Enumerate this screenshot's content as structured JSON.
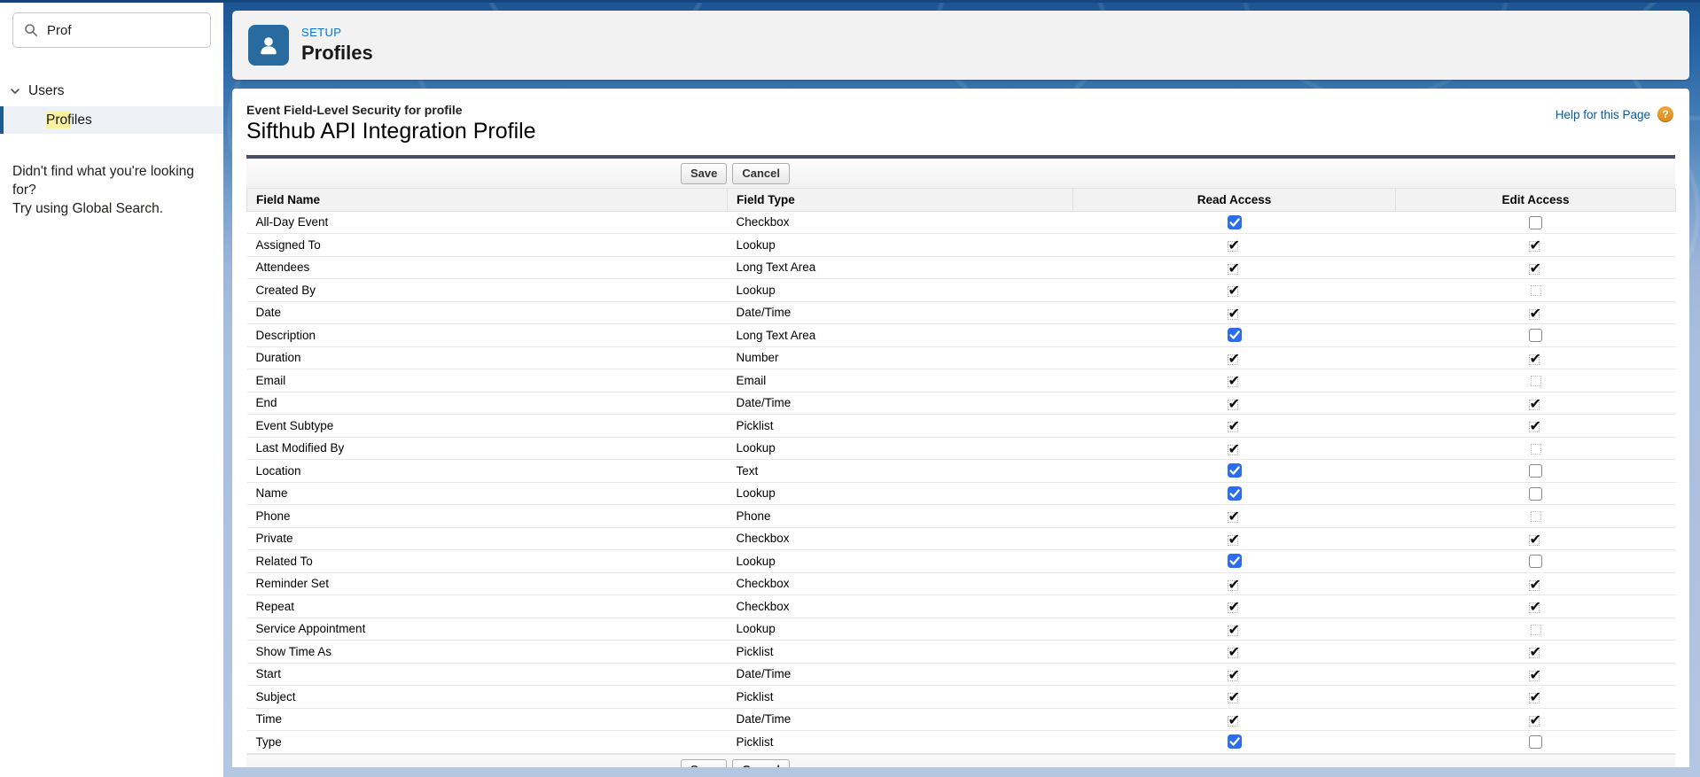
{
  "sidebar": {
    "search": {
      "value": "Prof"
    },
    "section_label": "Users",
    "item": {
      "highlight": "Prof",
      "rest": "iles"
    },
    "notfound_line1": "Didn't find what you're looking for?",
    "notfound_line2": "Try using Global Search."
  },
  "header": {
    "eyebrow": "SETUP",
    "title": "Profiles"
  },
  "page": {
    "subtitle": "Event Field-Level Security for profile",
    "title": "Sifthub API Integration Profile",
    "help_link": "Help for this Page",
    "help_icon_glyph": "?"
  },
  "toolbar": {
    "save_label": "Save",
    "cancel_label": "Cancel"
  },
  "table": {
    "columns": [
      "Field Name",
      "Field Type",
      "Read Access",
      "Edit Access"
    ],
    "rows": [
      {
        "name": "All-Day Event",
        "type": "Checkbox",
        "read": "checked",
        "edit": "unchecked"
      },
      {
        "name": "Assigned To",
        "type": "Lookup",
        "read": "check",
        "edit": "check"
      },
      {
        "name": "Attendees",
        "type": "Long Text Area",
        "read": "check",
        "edit": "check"
      },
      {
        "name": "Created By",
        "type": "Lookup",
        "read": "check",
        "edit": "none"
      },
      {
        "name": "Date",
        "type": "Date/Time",
        "read": "check",
        "edit": "check"
      },
      {
        "name": "Description",
        "type": "Long Text Area",
        "read": "checked",
        "edit": "unchecked"
      },
      {
        "name": "Duration",
        "type": "Number",
        "read": "check",
        "edit": "check"
      },
      {
        "name": "Email",
        "type": "Email",
        "read": "check",
        "edit": "none"
      },
      {
        "name": "End",
        "type": "Date/Time",
        "read": "check",
        "edit": "check"
      },
      {
        "name": "Event Subtype",
        "type": "Picklist",
        "read": "check",
        "edit": "check"
      },
      {
        "name": "Last Modified By",
        "type": "Lookup",
        "read": "check",
        "edit": "none"
      },
      {
        "name": "Location",
        "type": "Text",
        "read": "checked",
        "edit": "unchecked"
      },
      {
        "name": "Name",
        "type": "Lookup",
        "read": "checked",
        "edit": "unchecked"
      },
      {
        "name": "Phone",
        "type": "Phone",
        "read": "check",
        "edit": "none"
      },
      {
        "name": "Private",
        "type": "Checkbox",
        "read": "check",
        "edit": "check"
      },
      {
        "name": "Related To",
        "type": "Lookup",
        "read": "checked",
        "edit": "unchecked"
      },
      {
        "name": "Reminder Set",
        "type": "Checkbox",
        "read": "check",
        "edit": "check"
      },
      {
        "name": "Repeat",
        "type": "Checkbox",
        "read": "check",
        "edit": "check"
      },
      {
        "name": "Service Appointment",
        "type": "Lookup",
        "read": "check",
        "edit": "none"
      },
      {
        "name": "Show Time As",
        "type": "Picklist",
        "read": "check",
        "edit": "check"
      },
      {
        "name": "Start",
        "type": "Date/Time",
        "read": "check",
        "edit": "check"
      },
      {
        "name": "Subject",
        "type": "Picklist",
        "read": "check",
        "edit": "check"
      },
      {
        "name": "Time",
        "type": "Date/Time",
        "read": "check",
        "edit": "check"
      },
      {
        "name": "Type",
        "type": "Picklist",
        "read": "checked",
        "edit": "unchecked"
      }
    ]
  },
  "colors": {
    "accent_blue": "#0176d3",
    "icon_tile": "#2a6b9f",
    "checkbox_checked": "#2b6cf0",
    "table_top_border": "#4a4e69",
    "link": "#015ba7",
    "help_icon_orange": "#e99a2c",
    "search_highlight": "#f8f1a0",
    "bg_top": "#1c5492",
    "bg_bottom": "#b3c6e2"
  }
}
